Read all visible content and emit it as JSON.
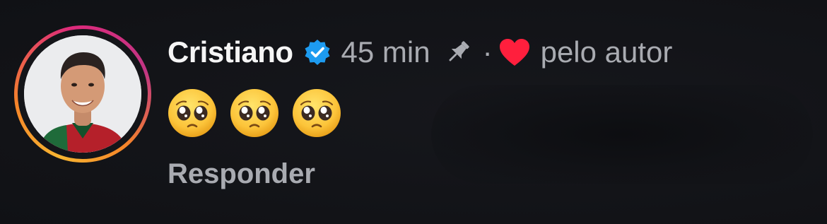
{
  "comment": {
    "username": "Cristiano",
    "verified_icon": "verified-badge-icon",
    "time": "45 min",
    "pinned_icon": "pin-icon",
    "separator": "·",
    "liked_icon": "heart-icon",
    "liked_by": "pelo autor",
    "emojis": [
      "pleading-face",
      "pleading-face",
      "pleading-face"
    ],
    "reply_label": "Responder"
  },
  "colors": {
    "background": "#141519",
    "username": "#f5f5f5",
    "meta": "#a9abb1",
    "verified": "#1d9bf0",
    "heart": "#ff1f3d"
  }
}
